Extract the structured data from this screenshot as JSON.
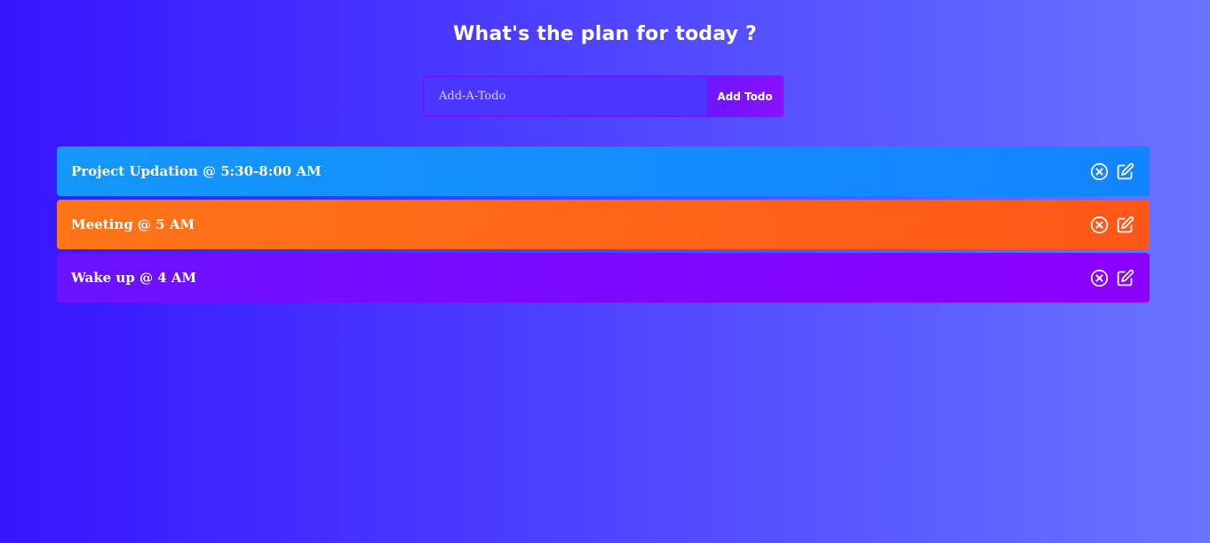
{
  "header": {
    "title": "What's the plan for today ?"
  },
  "form": {
    "placeholder": "Add-A-Todo",
    "value": "",
    "add_label": "Add Todo"
  },
  "todos": [
    {
      "text": "Project Updation @ 5:30-8:00 AM",
      "color": "#1597fb",
      "delete_icon": "close-circle-icon",
      "edit_icon": "edit-icon"
    },
    {
      "text": "Meeting @ 5 AM",
      "color": "#ff6a18",
      "delete_icon": "close-circle-icon",
      "edit_icon": "edit-icon"
    },
    {
      "text": "Wake up @ 4 AM",
      "color": "#7a0cff",
      "delete_icon": "close-circle-icon",
      "edit_icon": "edit-icon"
    }
  ]
}
